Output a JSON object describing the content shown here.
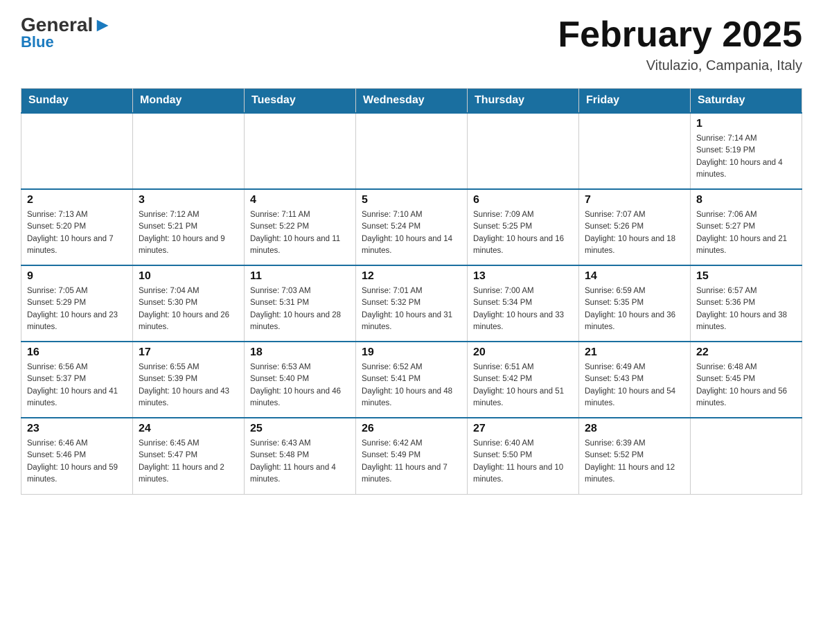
{
  "header": {
    "logo_general": "General",
    "logo_blue": "Blue",
    "title": "February 2025",
    "subtitle": "Vitulazio, Campania, Italy"
  },
  "days_of_week": [
    "Sunday",
    "Monday",
    "Tuesday",
    "Wednesday",
    "Thursday",
    "Friday",
    "Saturday"
  ],
  "weeks": [
    [
      {
        "day": "",
        "info": ""
      },
      {
        "day": "",
        "info": ""
      },
      {
        "day": "",
        "info": ""
      },
      {
        "day": "",
        "info": ""
      },
      {
        "day": "",
        "info": ""
      },
      {
        "day": "",
        "info": ""
      },
      {
        "day": "1",
        "info": "Sunrise: 7:14 AM\nSunset: 5:19 PM\nDaylight: 10 hours and 4 minutes."
      }
    ],
    [
      {
        "day": "2",
        "info": "Sunrise: 7:13 AM\nSunset: 5:20 PM\nDaylight: 10 hours and 7 minutes."
      },
      {
        "day": "3",
        "info": "Sunrise: 7:12 AM\nSunset: 5:21 PM\nDaylight: 10 hours and 9 minutes."
      },
      {
        "day": "4",
        "info": "Sunrise: 7:11 AM\nSunset: 5:22 PM\nDaylight: 10 hours and 11 minutes."
      },
      {
        "day": "5",
        "info": "Sunrise: 7:10 AM\nSunset: 5:24 PM\nDaylight: 10 hours and 14 minutes."
      },
      {
        "day": "6",
        "info": "Sunrise: 7:09 AM\nSunset: 5:25 PM\nDaylight: 10 hours and 16 minutes."
      },
      {
        "day": "7",
        "info": "Sunrise: 7:07 AM\nSunset: 5:26 PM\nDaylight: 10 hours and 18 minutes."
      },
      {
        "day": "8",
        "info": "Sunrise: 7:06 AM\nSunset: 5:27 PM\nDaylight: 10 hours and 21 minutes."
      }
    ],
    [
      {
        "day": "9",
        "info": "Sunrise: 7:05 AM\nSunset: 5:29 PM\nDaylight: 10 hours and 23 minutes."
      },
      {
        "day": "10",
        "info": "Sunrise: 7:04 AM\nSunset: 5:30 PM\nDaylight: 10 hours and 26 minutes."
      },
      {
        "day": "11",
        "info": "Sunrise: 7:03 AM\nSunset: 5:31 PM\nDaylight: 10 hours and 28 minutes."
      },
      {
        "day": "12",
        "info": "Sunrise: 7:01 AM\nSunset: 5:32 PM\nDaylight: 10 hours and 31 minutes."
      },
      {
        "day": "13",
        "info": "Sunrise: 7:00 AM\nSunset: 5:34 PM\nDaylight: 10 hours and 33 minutes."
      },
      {
        "day": "14",
        "info": "Sunrise: 6:59 AM\nSunset: 5:35 PM\nDaylight: 10 hours and 36 minutes."
      },
      {
        "day": "15",
        "info": "Sunrise: 6:57 AM\nSunset: 5:36 PM\nDaylight: 10 hours and 38 minutes."
      }
    ],
    [
      {
        "day": "16",
        "info": "Sunrise: 6:56 AM\nSunset: 5:37 PM\nDaylight: 10 hours and 41 minutes."
      },
      {
        "day": "17",
        "info": "Sunrise: 6:55 AM\nSunset: 5:39 PM\nDaylight: 10 hours and 43 minutes."
      },
      {
        "day": "18",
        "info": "Sunrise: 6:53 AM\nSunset: 5:40 PM\nDaylight: 10 hours and 46 minutes."
      },
      {
        "day": "19",
        "info": "Sunrise: 6:52 AM\nSunset: 5:41 PM\nDaylight: 10 hours and 48 minutes."
      },
      {
        "day": "20",
        "info": "Sunrise: 6:51 AM\nSunset: 5:42 PM\nDaylight: 10 hours and 51 minutes."
      },
      {
        "day": "21",
        "info": "Sunrise: 6:49 AM\nSunset: 5:43 PM\nDaylight: 10 hours and 54 minutes."
      },
      {
        "day": "22",
        "info": "Sunrise: 6:48 AM\nSunset: 5:45 PM\nDaylight: 10 hours and 56 minutes."
      }
    ],
    [
      {
        "day": "23",
        "info": "Sunrise: 6:46 AM\nSunset: 5:46 PM\nDaylight: 10 hours and 59 minutes."
      },
      {
        "day": "24",
        "info": "Sunrise: 6:45 AM\nSunset: 5:47 PM\nDaylight: 11 hours and 2 minutes."
      },
      {
        "day": "25",
        "info": "Sunrise: 6:43 AM\nSunset: 5:48 PM\nDaylight: 11 hours and 4 minutes."
      },
      {
        "day": "26",
        "info": "Sunrise: 6:42 AM\nSunset: 5:49 PM\nDaylight: 11 hours and 7 minutes."
      },
      {
        "day": "27",
        "info": "Sunrise: 6:40 AM\nSunset: 5:50 PM\nDaylight: 11 hours and 10 minutes."
      },
      {
        "day": "28",
        "info": "Sunrise: 6:39 AM\nSunset: 5:52 PM\nDaylight: 11 hours and 12 minutes."
      },
      {
        "day": "",
        "info": ""
      }
    ]
  ]
}
